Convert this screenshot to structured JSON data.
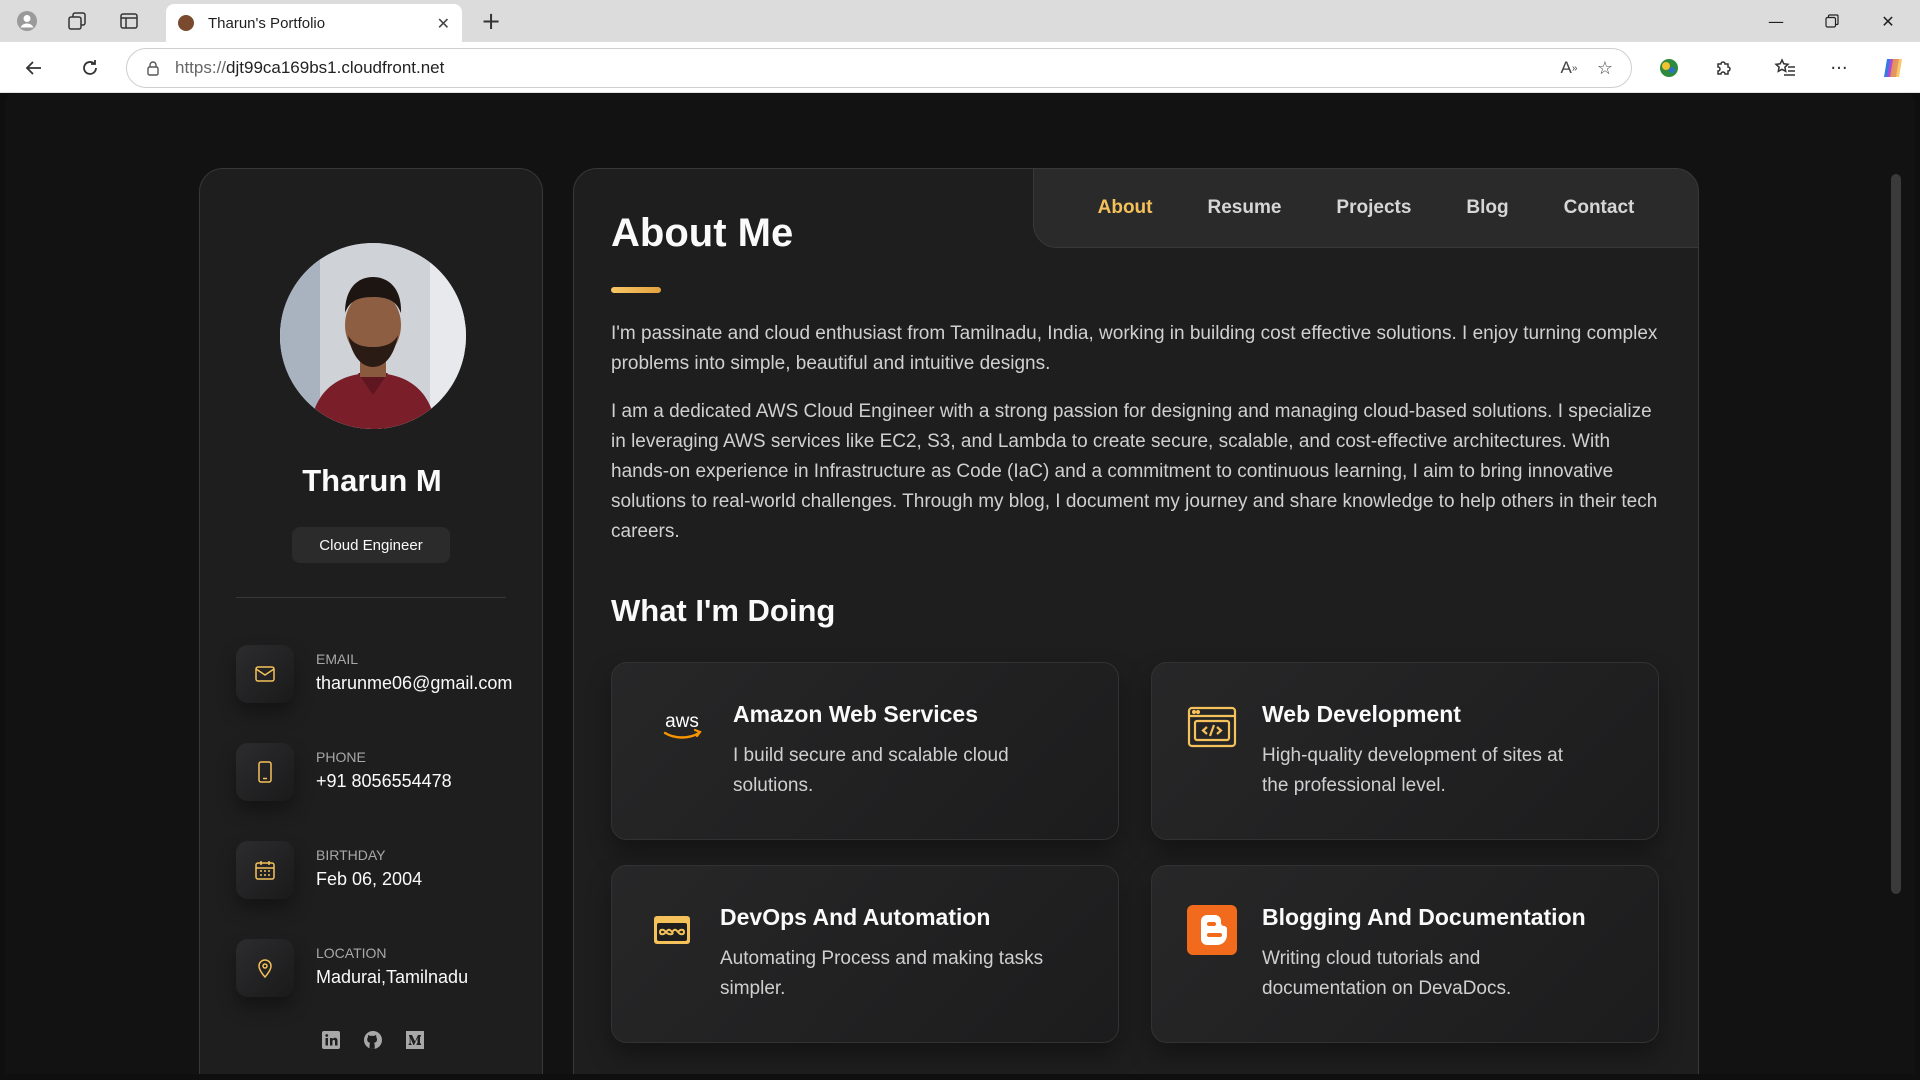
{
  "browser": {
    "tab_title": "Tharun's Portfolio",
    "url_protocol": "https://",
    "url_host": "djt99ca169bs1.cloudfront.net",
    "icons": [
      "profile-icon",
      "workspaces-icon",
      "tab-actions-icon",
      "close-icon",
      "new-tab-icon",
      "minimize-icon",
      "restore-icon",
      "close-window-icon",
      "back-icon",
      "refresh-icon",
      "lock-icon",
      "read-aloud-icon",
      "favorite-icon",
      "extension-icon",
      "puzzle-icon",
      "favorites-icon",
      "more-icon",
      "copilot-icon"
    ]
  },
  "profile": {
    "name": "Tharun M",
    "role": "Cloud Engineer",
    "contacts": [
      {
        "label": "Email",
        "value": "tharunme06@gmail.com",
        "icon": "mail-icon"
      },
      {
        "label": "Phone",
        "value": "+91 8056554478",
        "icon": "phone-icon"
      },
      {
        "label": "Birthday",
        "value": "Feb 06, 2004",
        "icon": "calendar-icon"
      },
      {
        "label": "Location",
        "value": "Madurai,Tamilnadu",
        "icon": "location-icon"
      }
    ],
    "socials": [
      "linkedin-icon",
      "github-icon",
      "medium-icon"
    ]
  },
  "nav": {
    "items": [
      {
        "label": "About",
        "active": true
      },
      {
        "label": "Resume",
        "active": false
      },
      {
        "label": "Projects",
        "active": false
      },
      {
        "label": "Blog",
        "active": false
      },
      {
        "label": "Contact",
        "active": false
      }
    ]
  },
  "about": {
    "heading": "About Me",
    "paragraphs": [
      "I'm passinate and cloud enthusiast from Tamilnadu, India, working in building cost effective solutions. I enjoy turning complex problems into simple, beautiful and intuitive designs.",
      "I am a dedicated AWS Cloud Engineer with a strong passion for designing and managing cloud-based solutions. I specialize in leveraging AWS services like EC2, S3, and Lambda to create secure, scalable, and cost-effective architectures. With hands-on experience in Infrastructure as Code (IaC) and a commitment to continuous learning, I aim to bring innovative solutions to real-world challenges. Through my blog, I document my journey and share knowledge to help others in their tech careers."
    ]
  },
  "services": {
    "heading": "What I'm Doing",
    "items": [
      {
        "title": "Amazon Web Services",
        "text": "I build secure and scalable cloud solutions.",
        "icon": "aws-icon",
        "icon_text": "aws"
      },
      {
        "title": "Web Development",
        "text": "High-quality development of sites at the professional level.",
        "icon": "code-window-icon"
      },
      {
        "title": "DevOps And Automation",
        "text": "Automating Process and making tasks simpler.",
        "icon": "devops-infinity-icon"
      },
      {
        "title": "Blogging And Documentation",
        "text": "Writing cloud tutorials and documentation on DevaDocs.",
        "icon": "blogger-icon"
      }
    ]
  },
  "colors": {
    "accent": "#f5c15a",
    "page_bg": "#121212",
    "card_bg": "#1e1e1f",
    "blogger_orange": "#f26a1b"
  }
}
